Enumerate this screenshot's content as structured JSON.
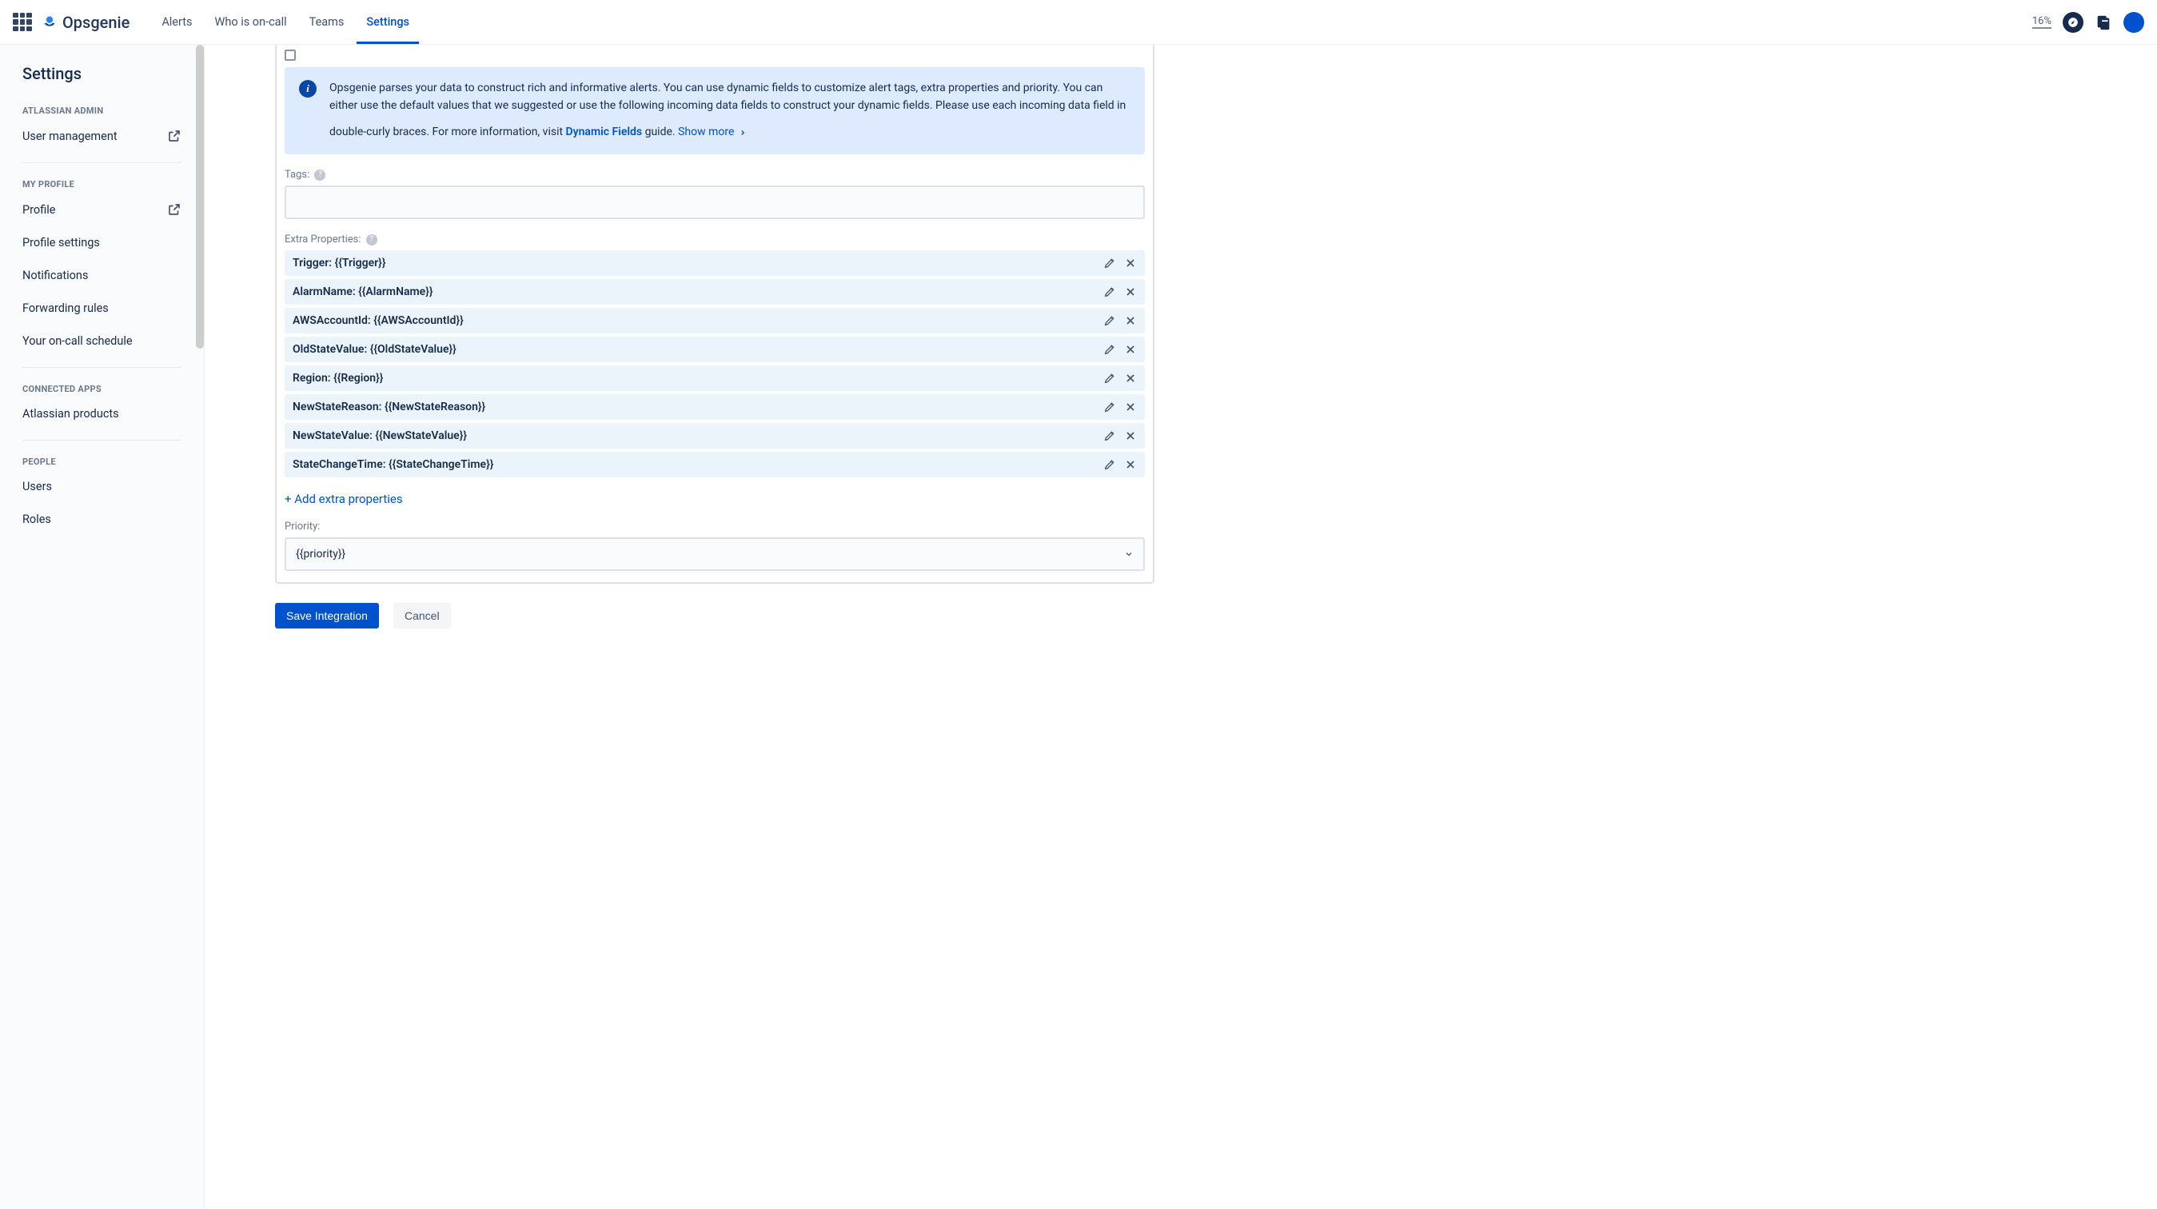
{
  "header": {
    "product": "Opsgenie",
    "nav": [
      "Alerts",
      "Who is on-call",
      "Teams",
      "Settings"
    ],
    "active_nav_index": 3,
    "percent": "16%"
  },
  "sidebar": {
    "title": "Settings",
    "sections": [
      {
        "label": "ATLASSIAN ADMIN",
        "items": [
          {
            "label": "User management",
            "external": true
          }
        ]
      },
      {
        "label": "MY PROFILE",
        "items": [
          {
            "label": "Profile",
            "external": true
          },
          {
            "label": "Profile settings",
            "external": false
          },
          {
            "label": "Notifications",
            "external": false
          },
          {
            "label": "Forwarding rules",
            "external": false
          },
          {
            "label": "Your on-call schedule",
            "external": false
          }
        ]
      },
      {
        "label": "CONNECTED APPS",
        "items": [
          {
            "label": "Atlassian products",
            "external": false
          }
        ]
      },
      {
        "label": "PEOPLE",
        "items": [
          {
            "label": "Users",
            "external": false
          },
          {
            "label": "Roles",
            "external": false
          }
        ]
      }
    ]
  },
  "info": {
    "text_before_link": "Opsgenie parses your data to construct rich and informative alerts. You can use dynamic fields to customize alert tags, extra properties and priority. You can either use the default values that we suggested or use the following incoming data fields to construct your dynamic fields. Please use each incoming data field in double-curly braces. For more information, visit ",
    "link_text": "Dynamic Fields",
    "text_after_link": " guide.",
    "show_more": "Show more"
  },
  "form": {
    "tags_label": "Tags:",
    "extra_props_label": "Extra Properties:",
    "properties": [
      "Trigger: {{Trigger}}",
      "AlarmName: {{AlarmName}}",
      "AWSAccountId: {{AWSAccountId}}",
      "OldStateValue: {{OldStateValue}}",
      "Region: {{Region}}",
      "NewStateReason: {{NewStateReason}}",
      "NewStateValue: {{NewStateValue}}",
      "StateChangeTime: {{StateChangeTime}}"
    ],
    "add_link": "+ Add extra properties",
    "priority_label": "Priority:",
    "priority_value": "{{priority}}"
  },
  "buttons": {
    "save": "Save Integration",
    "cancel": "Cancel"
  }
}
